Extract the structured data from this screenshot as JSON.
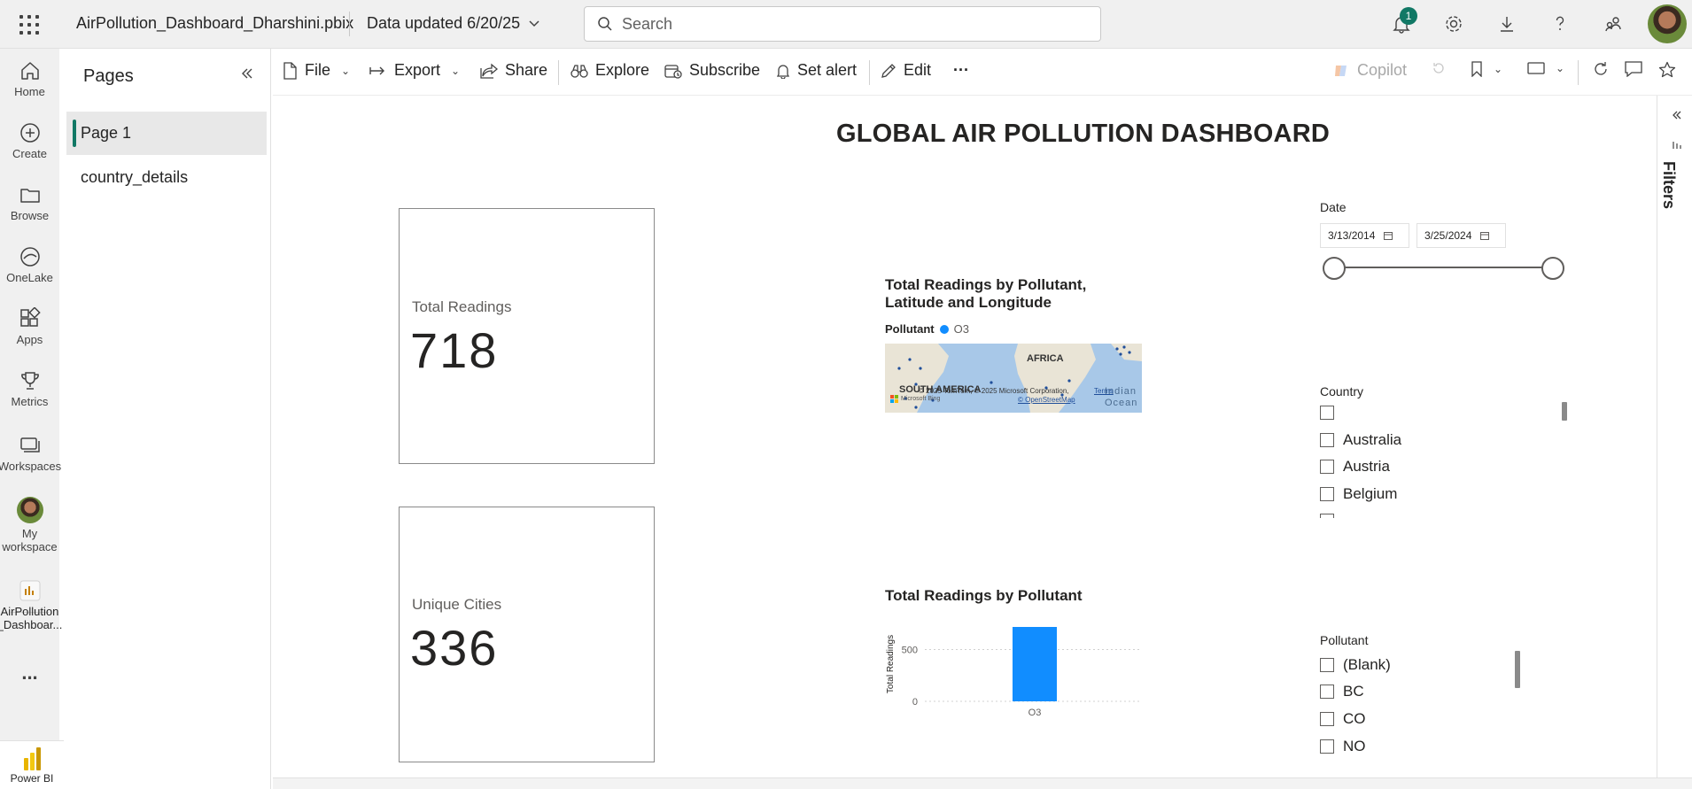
{
  "topbar": {
    "app_title": "AirPollution_Dashboard_Dharshini.pbix",
    "data_updated": "Data updated 6/20/25",
    "search_placeholder": "Search",
    "notification_count": "1"
  },
  "nav": {
    "items": [
      {
        "label": "Home",
        "icon": "home-icon"
      },
      {
        "label": "Create",
        "icon": "create-icon"
      },
      {
        "label": "Browse",
        "icon": "folder-icon"
      },
      {
        "label": "OneLake",
        "icon": "onelake-icon"
      },
      {
        "label": "Apps",
        "icon": "apps-icon"
      },
      {
        "label": "Metrics",
        "icon": "trophy-icon"
      },
      {
        "label": "Workspaces",
        "icon": "workspaces-icon"
      }
    ],
    "my_workspace_line1": "My",
    "my_workspace_line2": "workspace",
    "report_line1": "AirPollution",
    "report_line2": "_Dashboar...",
    "more": "...",
    "product": "Power BI"
  },
  "pages": {
    "title": "Pages",
    "items": [
      {
        "label": "Page 1",
        "active": true
      },
      {
        "label": "country_details",
        "active": false
      }
    ]
  },
  "toolbar": {
    "file": "File",
    "export": "Export",
    "share": "Share",
    "explore": "Explore",
    "subscribe": "Subscribe",
    "set_alert": "Set alert",
    "edit": "Edit",
    "more": "···",
    "copilot": "Copilot"
  },
  "dashboard": {
    "title": "GLOBAL AIR POLLUTION DASHBOARD",
    "card1": {
      "label": "Total Readings",
      "value": "718"
    },
    "card2": {
      "label": "Unique Cities",
      "value": "336"
    },
    "map": {
      "title_line1": "Total Readings by Pollutant,",
      "title_line2": "Latitude and Longitude",
      "legend_title": "Pollutant",
      "legend_item": "O3",
      "label_africa": "AFRICA",
      "label_south_america": "SOUTH AMERICA",
      "label_ocean1": "Indian",
      "label_ocean2": "Ocean",
      "copyright": "© 2025 TomTom, © 2025 Microsoft Corporation,",
      "osm": "© OpenStreetMap",
      "terms": "Terms",
      "bing": "Microsoft Bing"
    },
    "date_slicer": {
      "title": "Date",
      "start": "3/13/2014",
      "end": "3/25/2024"
    },
    "country_slicer": {
      "title": "Country",
      "items": [
        "",
        "Australia",
        "Austria",
        "Belgium"
      ]
    },
    "pollutant_slicer": {
      "title": "Pollutant",
      "items": [
        "(Blank)",
        "BC",
        "CO",
        "NO"
      ]
    },
    "filters_label": "Filters"
  },
  "chart_data": {
    "type": "bar",
    "title": "Total Readings by Pollutant",
    "categories": [
      "O3"
    ],
    "values": [
      718
    ],
    "xlabel": "",
    "ylabel": "Total Readings",
    "yticks": [
      0,
      500
    ],
    "ylim": [
      0,
      718
    ],
    "grid": true,
    "color": "#118dff"
  },
  "colors": {
    "accent": "#117865",
    "bar": "#118dff"
  }
}
